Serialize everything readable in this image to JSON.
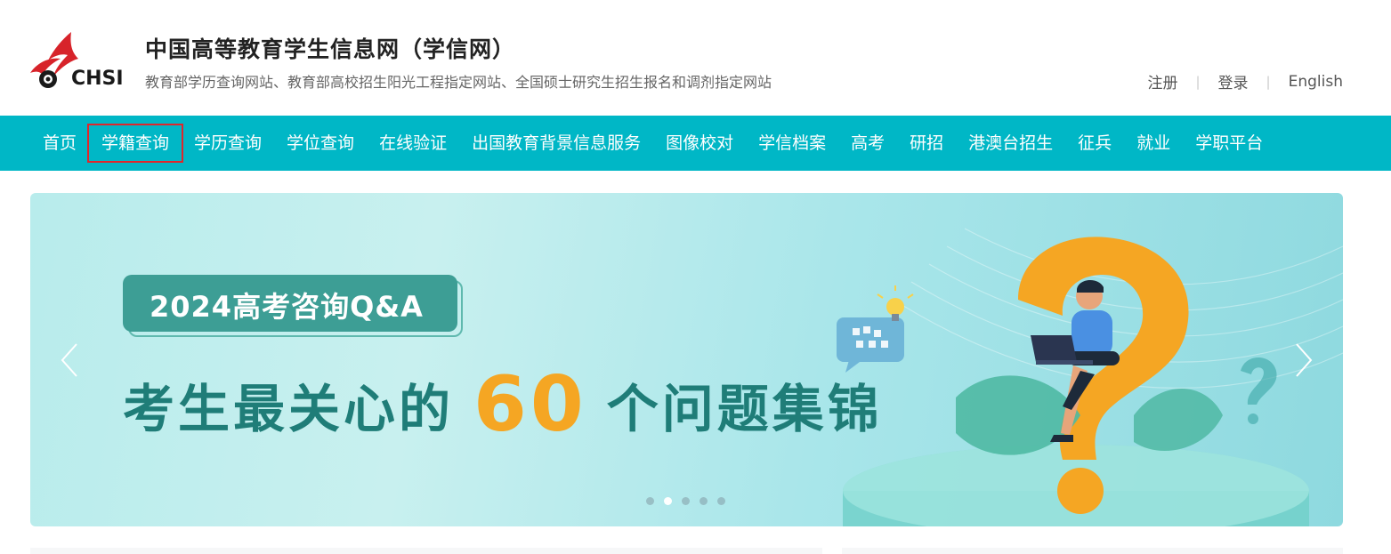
{
  "brand": {
    "logo_text": "CHSI",
    "title": "中国高等教育学生信息网（学信网）",
    "subtitle": "教育部学历查询网站、教育部高校招生阳光工程指定网站、全国硕士研究生招生报名和调剂指定网站",
    "accent_color": "#00b7c6",
    "logo_red": "#d7232a"
  },
  "top_links": {
    "register": "注册",
    "login": "登录",
    "english": "English"
  },
  "nav": {
    "items": [
      {
        "label": "首页"
      },
      {
        "label": "学籍查询"
      },
      {
        "label": "学历查询"
      },
      {
        "label": "学位查询"
      },
      {
        "label": "在线验证"
      },
      {
        "label": "出国教育背景信息服务"
      },
      {
        "label": "图像校对"
      },
      {
        "label": "学信档案"
      },
      {
        "label": "高考"
      },
      {
        "label": "研招"
      },
      {
        "label": "港澳台招生"
      },
      {
        "label": "征兵"
      },
      {
        "label": "就业"
      },
      {
        "label": "学职平台"
      }
    ],
    "highlighted_index": 1
  },
  "banner": {
    "tag": "2024高考咨询Q&A",
    "headline_prefix": "考生最关心的",
    "headline_number": "60",
    "headline_suffix": "个问题集锦",
    "slide_count": 5,
    "active_slide": 1
  }
}
